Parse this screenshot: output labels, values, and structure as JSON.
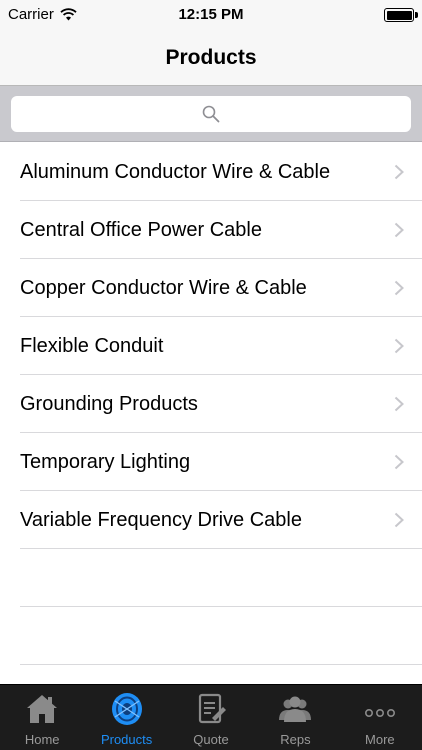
{
  "status_bar": {
    "carrier": "Carrier",
    "time": "12:15 PM",
    "battery_level": 1.0
  },
  "nav": {
    "title": "Products"
  },
  "search": {
    "placeholder": "",
    "icon": "search-icon"
  },
  "products": [
    {
      "label": "Aluminum Conductor Wire & Cable"
    },
    {
      "label": "Central Office Power Cable"
    },
    {
      "label": "Copper Conductor Wire & Cable"
    },
    {
      "label": "Flexible Conduit"
    },
    {
      "label": "Grounding Products"
    },
    {
      "label": "Temporary Lighting"
    },
    {
      "label": "Variable Frequency Drive Cable"
    }
  ],
  "tabs": [
    {
      "label": "Home",
      "icon": "home-icon",
      "active": false
    },
    {
      "label": "Products",
      "icon": "cable-reel-icon",
      "active": true
    },
    {
      "label": "Quote",
      "icon": "quote-icon",
      "active": false
    },
    {
      "label": "Reps",
      "icon": "people-icon",
      "active": false
    },
    {
      "label": "More",
      "icon": "more-icon",
      "active": false
    }
  ],
  "colors": {
    "accent": "#1e8ef5",
    "tab_bar": "#1c1c1c",
    "inactive_tab": "#9a9a9a"
  }
}
